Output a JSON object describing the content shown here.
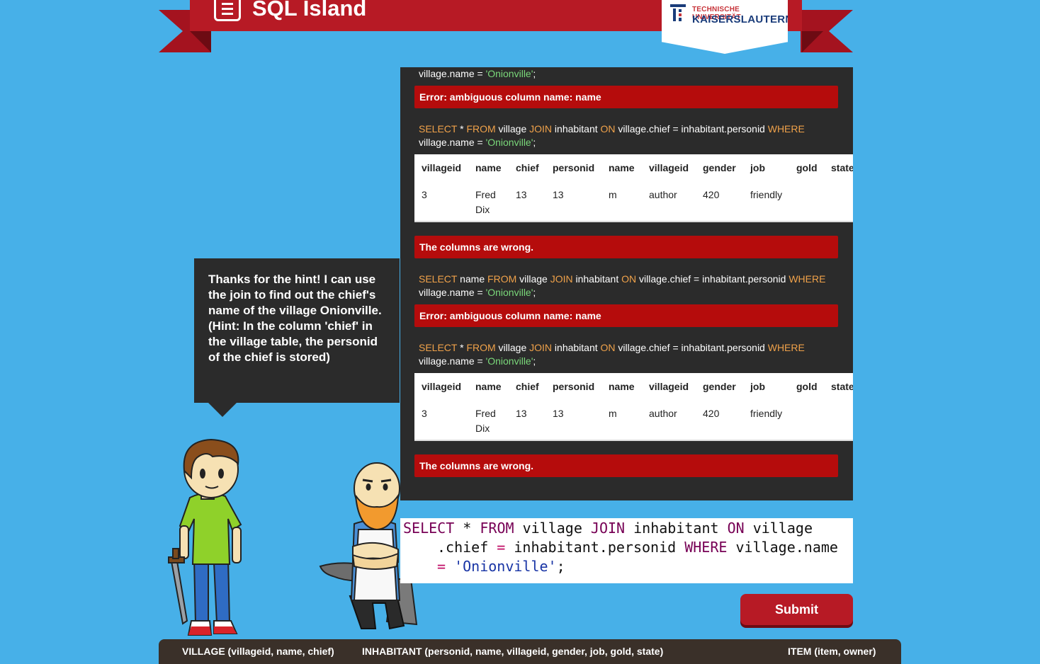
{
  "header": {
    "title": "SQL Island",
    "university_line1": "TECHNISCHE UNIVERSITÄT",
    "university_line2": "KAISERSLAUTERN"
  },
  "log": {
    "top_line": [
      "village.name = ",
      "'Onionville'",
      ";"
    ],
    "errors": {
      "ambiguous": "Error: ambiguous column name: name",
      "wrong_columns": "The columns are wrong."
    },
    "query_select_star": {
      "kw_select": "SELECT",
      "t1": " * ",
      "kw_from": "FROM",
      "t2": " village ",
      "kw_join": "JOIN",
      "t3": " inhabitant ",
      "kw_on": "ON",
      "t4": " village.chief = inhabitant.personid ",
      "kw_where": "WHERE",
      "t5": "village.name = ",
      "str": "'Onionville'",
      "t6": ";"
    },
    "query_select_name": {
      "kw_select": "SELECT",
      "t1": " name ",
      "kw_from": "FROM",
      "t2": " village ",
      "kw_join": "JOIN",
      "t3": " inhabitant ",
      "kw_on": "ON",
      "t4": " village.chief = inhabitant.personid ",
      "kw_where": "WHERE",
      "t5": "village.name = ",
      "str": "'Onionville'",
      "t6": ";"
    },
    "result_table": {
      "headers": [
        "villageid",
        "name",
        "chief",
        "personid",
        "name",
        "villageid",
        "gender",
        "job",
        "gold",
        "state"
      ],
      "row": [
        "3",
        "Fred Dix",
        "13",
        "13",
        "m",
        "author",
        "420",
        "friendly",
        "",
        ""
      ]
    }
  },
  "bubble": {
    "text": "Thanks for the hint! I can use the join to find out the chief's name of the village Onionville. (Hint: In the column 'chief' in the village table, the personid of the chief is stored)"
  },
  "editor": {
    "kw_select": "SELECT",
    "t1": " * ",
    "kw_from": "FROM",
    "t2": " village ",
    "kw_join": "JOIN",
    "t3": " inhabitant ",
    "kw_on": "ON",
    "t4": " village",
    "t5": ".chief ",
    "op_eq1": "=",
    "t6": " inhabitant.personid ",
    "kw_where": "WHERE",
    "t7": " village.name",
    "op_eq2": "=",
    "t8": " ",
    "str": "'Onionville'",
    "t9": ";"
  },
  "actions": {
    "submit": "Submit"
  },
  "schema": {
    "village": "VILLAGE (villageid, name, chief)",
    "inhabitant": "INHABITANT (personid, name, villageid, gender, job, gold, state)",
    "item": "ITEM (item, owner)"
  }
}
